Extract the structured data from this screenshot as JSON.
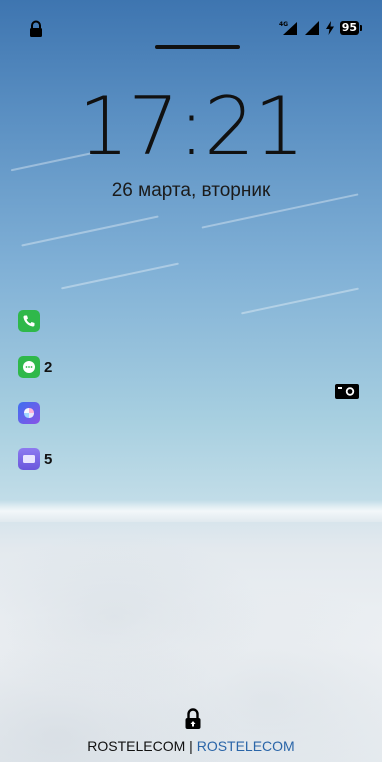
{
  "status_bar": {
    "network_label": "4G",
    "battery_level": "95"
  },
  "lockscreen": {
    "time": "17:21",
    "date": "26 марта, вторник"
  },
  "notifications": [
    {
      "app": "phone",
      "icon": "phone-icon",
      "color": "#2fb84a",
      "count": ""
    },
    {
      "app": "messages",
      "icon": "messages-icon",
      "color": "#2fb84a",
      "count": "2"
    },
    {
      "app": "gallery",
      "icon": "gallery-icon",
      "color": "#4a7be8",
      "count": ""
    },
    {
      "app": "mail",
      "icon": "mail-icon",
      "color": "#7a68e0",
      "count": "5"
    }
  ],
  "carrier": {
    "primary": "ROSTELECOM",
    "separator": "|",
    "secondary": "ROSTELECOM"
  }
}
